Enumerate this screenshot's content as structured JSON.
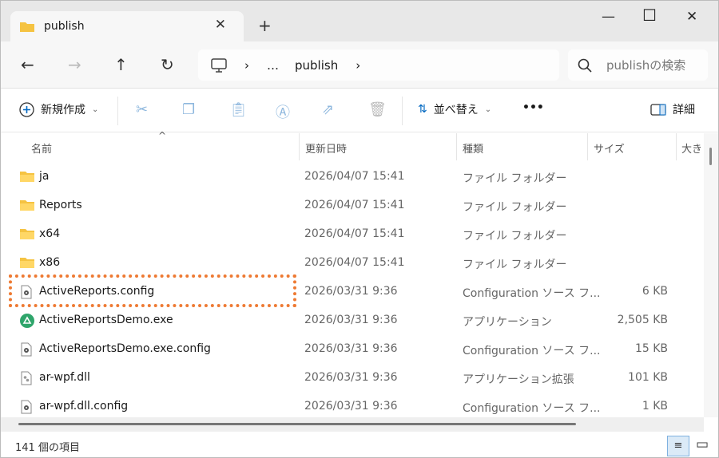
{
  "tab": {
    "title": "publish"
  },
  "address": {
    "path": [
      "…",
      "publish"
    ]
  },
  "search": {
    "placeholder": "publishの検索"
  },
  "toolbar": {
    "new": "新規作成",
    "sort": "並べ替え",
    "more": "•••",
    "details": "詳細"
  },
  "columns": [
    "名前",
    "更新日時",
    "種類",
    "サイズ",
    "大き"
  ],
  "files": [
    {
      "name": "ja",
      "date": "2026/04/07 15:41",
      "type": "ファイル フォルダー",
      "size": "",
      "icon": "folder"
    },
    {
      "name": "Reports",
      "date": "2026/04/07 15:41",
      "type": "ファイル フォルダー",
      "size": "",
      "icon": "folder"
    },
    {
      "name": "x64",
      "date": "2026/04/07 15:41",
      "type": "ファイル フォルダー",
      "size": "",
      "icon": "folder"
    },
    {
      "name": "x86",
      "date": "2026/04/07 15:41",
      "type": "ファイル フォルダー",
      "size": "",
      "icon": "folder"
    },
    {
      "name": "ActiveReports.config",
      "date": "2026/03/31 9:36",
      "type": "Configuration ソース フ...",
      "size": "6 KB",
      "icon": "config"
    },
    {
      "name": "ActiveReportsDemo.exe",
      "date": "2026/03/31 9:36",
      "type": "アプリケーション",
      "size": "2,505 KB",
      "icon": "app"
    },
    {
      "name": "ActiveReportsDemo.exe.config",
      "date": "2026/03/31 9:36",
      "type": "Configuration ソース フ...",
      "size": "15 KB",
      "icon": "config"
    },
    {
      "name": "ar-wpf.dll",
      "date": "2026/03/31 9:36",
      "type": "アプリケーション拡張",
      "size": "101 KB",
      "icon": "dll"
    },
    {
      "name": "ar-wpf.dll.config",
      "date": "2026/03/31 9:36",
      "type": "Configuration ソース フ...",
      "size": "1 KB",
      "icon": "config"
    }
  ],
  "status": {
    "count": "141 個の項目"
  },
  "colors": {
    "highlight": "#ee7a33",
    "folder": "#f5c342",
    "accent": "#0067c0"
  }
}
